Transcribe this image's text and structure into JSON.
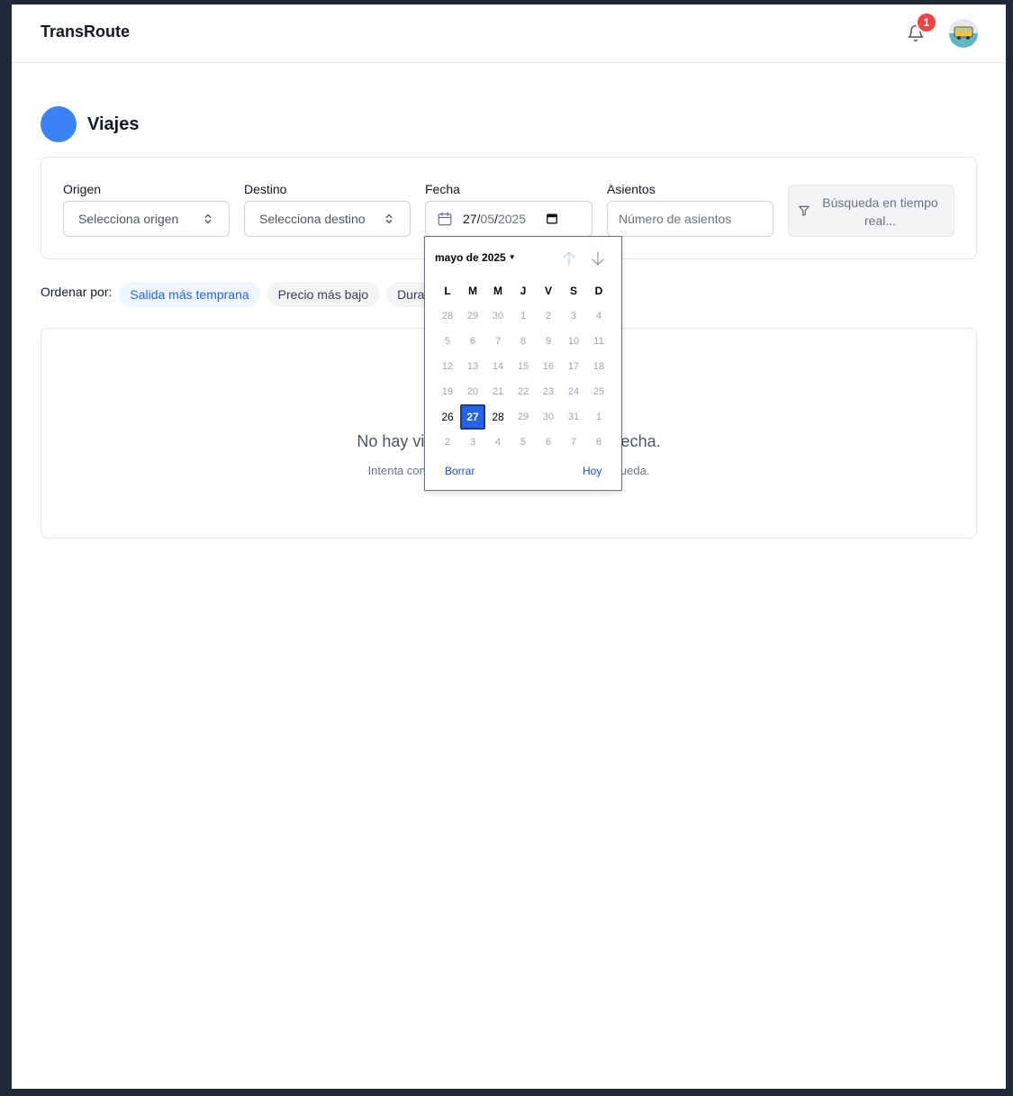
{
  "app": {
    "brand": "TransRoute",
    "notification_count": "1"
  },
  "page": {
    "title": "Viajes"
  },
  "filters": {
    "origin": {
      "label": "Origen",
      "value": "Selecciona origen"
    },
    "destination": {
      "label": "Destino",
      "value": "Selecciona destino"
    },
    "date": {
      "label": "Fecha",
      "day": "27",
      "month": "05",
      "year": "2025"
    },
    "seats": {
      "label": "Asientos",
      "placeholder": "Número de asientos"
    },
    "realtime_button": "Búsqueda en tiempo real..."
  },
  "sort": {
    "label": "Ordenar por:",
    "options": [
      "Salida más temprana",
      "Precio más bajo",
      "Duración"
    ],
    "active": "Salida más temprana"
  },
  "results": {
    "empty_title": "No hay viajes disponibles para esta fecha.",
    "empty_subtitle": "Intenta con otra fecha o ajusta tus filtros de búsqueda."
  },
  "datepicker": {
    "month_label": "mayo de 2025",
    "weekdays": [
      "L",
      "M",
      "M",
      "J",
      "V",
      "S",
      "D"
    ],
    "weeks": [
      [
        "28",
        "29",
        "30",
        "1",
        "2",
        "3",
        "4"
      ],
      [
        "5",
        "6",
        "7",
        "8",
        "9",
        "10",
        "11"
      ],
      [
        "12",
        "13",
        "14",
        "15",
        "16",
        "17",
        "18"
      ],
      [
        "19",
        "20",
        "21",
        "22",
        "23",
        "24",
        "25"
      ],
      [
        "26",
        "27",
        "28",
        "29",
        "30",
        "31",
        "1"
      ],
      [
        "2",
        "3",
        "4",
        "5",
        "6",
        "7",
        "8"
      ]
    ],
    "selected": "27",
    "clear_label": "Borrar",
    "today_label": "Hoy"
  },
  "colors": {
    "accent": "#3b82f6",
    "badge": "#ef4444",
    "selected_day": "#2563eb"
  },
  "icons": [
    "bell-icon",
    "avatar",
    "calendar-icon",
    "chevron-updown-icon",
    "filter-icon",
    "arrow-up-icon",
    "arrow-down-icon"
  ]
}
